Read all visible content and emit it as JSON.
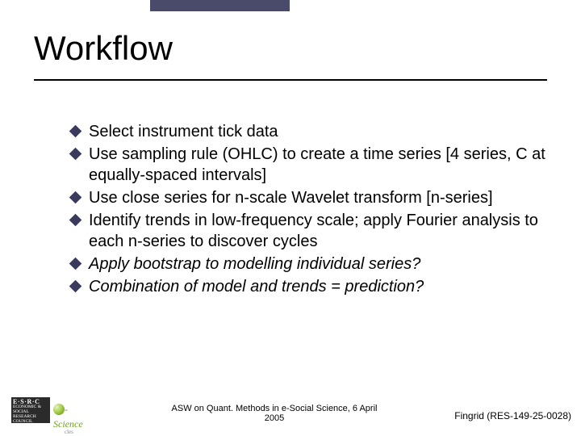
{
  "title": "Workflow",
  "bullets": [
    {
      "text": "Select instrument tick data",
      "italic": false
    },
    {
      "text": "Use sampling rule (OHLC) to create a time series [4 series, C at equally-spaced intervals]",
      "italic": false
    },
    {
      "text": "Use close series for n-scale Wavelet transform [n-series]",
      "italic": false
    },
    {
      "text": "Identify trends in low-frequency scale; apply Fourier analysis to each n-series to discover cycles",
      "italic": false
    },
    {
      "text": "Apply bootstrap to modelling individual series?",
      "italic": true
    },
    {
      "text": "Combination of model and trends = prediction?",
      "italic": true
    }
  ],
  "logos": {
    "esrc_big": "E·S·R·C",
    "esrc_small": "ECONOMIC & SOCIAL RESEARCH COUNCIL",
    "esci_text": "-Science",
    "esci_sub": "cles"
  },
  "footer": {
    "center": "ASW on Quant. Methods in e-Social Science, 6 April 2005",
    "right": "Fingrid (RES-149-25-0028)"
  }
}
